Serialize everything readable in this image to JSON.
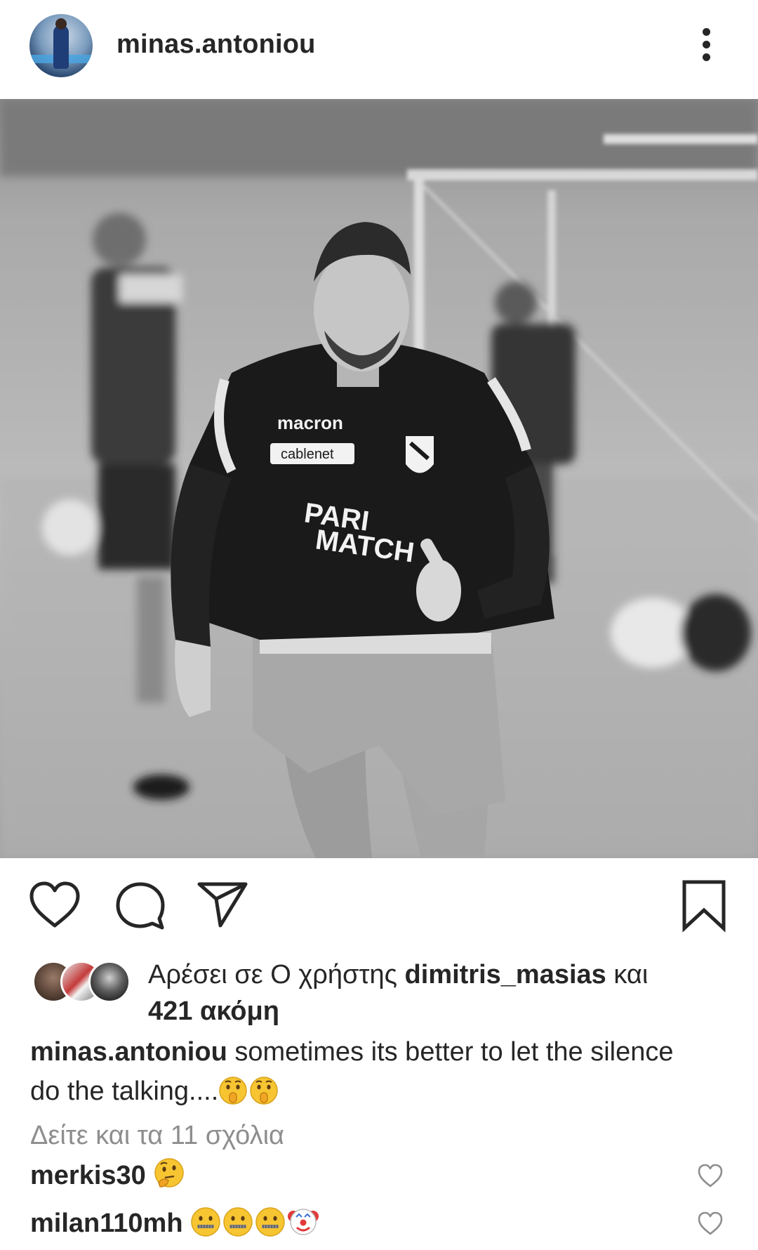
{
  "post": {
    "username": "minas.antoniou",
    "photo_description": "Black and white photo of football player running in training kit"
  },
  "likes": {
    "prefix": "Αρέσει σε Ο χρήστης",
    "user": "dimitris_masias",
    "connector": "και",
    "count": "421 ακόμη"
  },
  "caption": {
    "username": "minas.antoniou",
    "text": "sometimes its better to let the silence do the talking....",
    "emojis": [
      "shushing-face",
      "shushing-face"
    ]
  },
  "view_comments": "Δείτε και τα 11 σχόλια",
  "comments": [
    {
      "username": "merkis30",
      "emojis": [
        "thinking-face"
      ]
    },
    {
      "username": "milan110mh",
      "emojis": [
        "zipper-mouth-face",
        "zipper-mouth-face",
        "zipper-mouth-face",
        "clown-face"
      ]
    }
  ],
  "icons": {
    "like": "heart-icon",
    "comment": "comment-icon",
    "share": "paper-plane-icon",
    "save": "bookmark-icon",
    "more": "more-dots-icon"
  }
}
